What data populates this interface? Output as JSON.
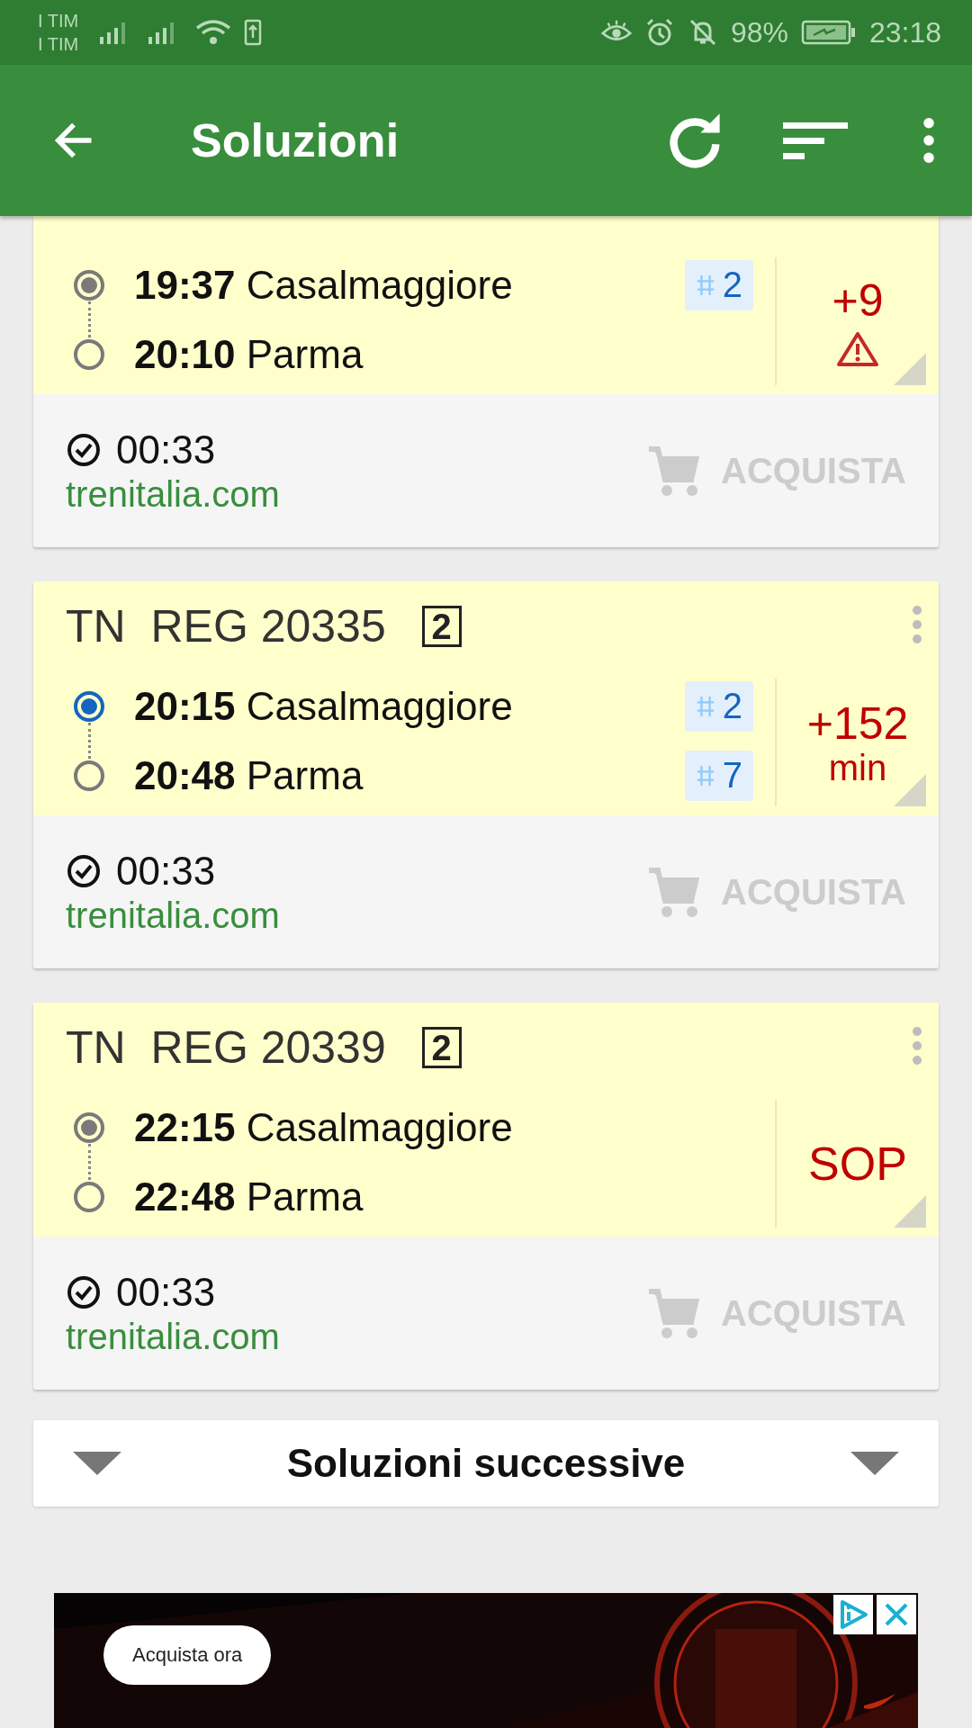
{
  "status_bar": {
    "carriers": [
      "I TIM",
      "I TIM"
    ],
    "battery": "98%",
    "time": "23:18"
  },
  "app_bar": {
    "title": "Soluzioni"
  },
  "solutions": [
    {
      "stops": [
        {
          "time": "19:37",
          "station": "Casalmaggiore",
          "platform": "2",
          "selected": false
        },
        {
          "time": "20:10",
          "station": "Parma"
        }
      ],
      "delay": {
        "text": "+9",
        "warning": true
      },
      "duration": "00:33",
      "provider": "trenitalia.com",
      "buy": "ACQUISTA"
    },
    {
      "train": {
        "category": "TN",
        "number": "REG 20335",
        "class": "2"
      },
      "stops": [
        {
          "time": "20:15",
          "station": "Casalmaggiore",
          "platform": "2",
          "selected": true
        },
        {
          "time": "20:48",
          "station": "Parma",
          "platform": "7"
        }
      ],
      "delay": {
        "text": "+152",
        "unit": "min",
        "warning": false
      },
      "duration": "00:33",
      "provider": "trenitalia.com",
      "buy": "ACQUISTA"
    },
    {
      "train": {
        "category": "TN",
        "number": "REG 20339",
        "class": "2"
      },
      "stops": [
        {
          "time": "22:15",
          "station": "Casalmaggiore",
          "selected": false
        },
        {
          "time": "22:48",
          "station": "Parma"
        }
      ],
      "delay": {
        "text": "SOP",
        "warning": false
      },
      "duration": "00:33",
      "provider": "trenitalia.com",
      "buy": "ACQUISTA"
    }
  ],
  "next_button": "Soluzioni successive",
  "ad": {
    "kind": "picture",
    "button": "Acquista ora"
  }
}
